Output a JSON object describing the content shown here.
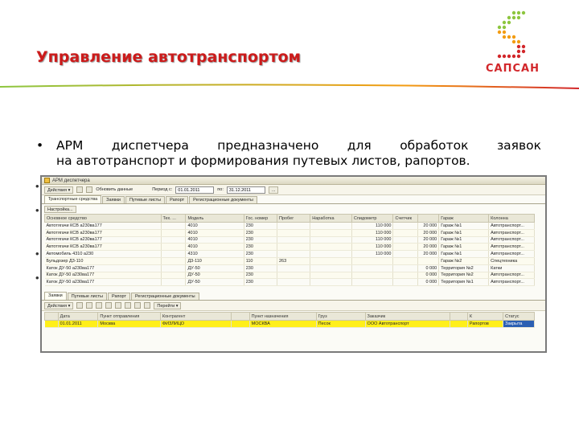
{
  "slide": {
    "title": "Управление автотранспортом",
    "brand": "САПСАН",
    "bullet_line1": [
      "АРМ",
      "диспетчера",
      "предназначено",
      "для",
      "обработок",
      "заявок"
    ],
    "bullet_line2": "на автотранспорт и формирования путевых листов, рапортов.",
    "colors": {
      "title": "#cc1b1b",
      "logo_green": "#8dc63f",
      "logo_orange": "#f39c12",
      "logo_red": "#d2262a"
    }
  },
  "window": {
    "title": "АРМ диспетчера",
    "toolbar": {
      "actions": "Действия ▾",
      "refresh": "Обновить данные",
      "period_label": "Период с:",
      "period_from": "01.01.2011",
      "period_to_label": "по:",
      "period_to": "31.12.2011",
      "more": "..."
    },
    "tabs": [
      "Транспортные средства",
      "Заявки",
      "Путевые листы",
      "Рапорт",
      "Регистрационные документы"
    ],
    "settings_button": "Настройка...",
    "columns": [
      "Основное средство",
      "Тех. ...",
      "Модель",
      "Гос. номер",
      "Пробег",
      "Наработка",
      "Спидометр",
      "Счетчик",
      "",
      "Гараж",
      "Колонна"
    ],
    "rows": [
      [
        "Автотягачи КСВ а230ва177",
        "",
        "4010",
        "230",
        "",
        "",
        "110 000",
        "",
        "20 000",
        "Гараж №1",
        "Автотранспорт..."
      ],
      [
        "Автотягачи КСВ а230ва177",
        "",
        "4010",
        "230",
        "",
        "",
        "110 000",
        "",
        "20 000",
        "Гараж №1",
        "Автотранспорт..."
      ],
      [
        "Автотягачи КСВ а230ва177",
        "",
        "4010",
        "230",
        "",
        "",
        "110 000",
        "",
        "20 000",
        "Гараж №1",
        "Автотранспорт..."
      ],
      [
        "Автотягачи КСВ а230ва177",
        "",
        "4010",
        "230",
        "",
        "",
        "110 000",
        "",
        "20 000",
        "Гараж №1",
        "Автотранспорт..."
      ],
      [
        "Автомобиль 4310 а230",
        "",
        "4310",
        "230",
        "",
        "",
        "110 000",
        "",
        "20 000",
        "Гараж №1",
        "Автотранспорт..."
      ],
      [
        "Бульдозер Д3-110",
        "",
        "Д3-110",
        "110",
        "263",
        "",
        "",
        "",
        "",
        "Гараж №2",
        "Спецтехника"
      ],
      [
        "Каток ДУ-50 а230ва177",
        "",
        "ДУ-50",
        "230",
        "",
        "",
        "",
        "",
        "0 000",
        "Территория №2",
        "Катки"
      ],
      [
        "Каток ДУ-50 а230ва177",
        "",
        "ДУ-50",
        "230",
        "",
        "",
        "",
        "",
        "0 000",
        "Территория №2",
        "Автотранспорт..."
      ],
      [
        "Каток ДУ-50 а230ва177",
        "",
        "ДУ-50",
        "230",
        "",
        "",
        "",
        "",
        "0 000",
        "Территория №1",
        "Автотранспорт..."
      ]
    ],
    "bottom_tabs": [
      "Заявки",
      "Путевые листы",
      "Рапорт",
      "Регистрационные документы"
    ],
    "bottom_toolbar": {
      "actions": "Действия ▾",
      "goto": "Перейти ▾"
    },
    "bottom_columns": [
      "",
      "Дата",
      "Пункт отправления",
      "Контрагент",
      "",
      "Пункт назначения",
      "Груз",
      "Заказчик",
      "",
      "К",
      "Статус"
    ],
    "bottom_row": [
      "",
      "01.01.2011",
      "Москва",
      "ФИЗЛИЦО",
      "",
      "МОСКВА",
      "Песок",
      "ООО Автотранспорт",
      "",
      "Рапортов",
      "Закрыта"
    ]
  }
}
